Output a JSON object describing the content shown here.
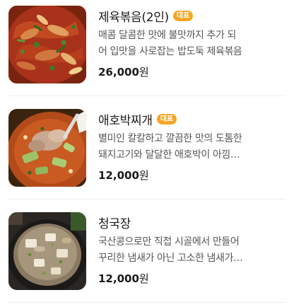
{
  "menu": {
    "items": [
      {
        "name": "제육볶음(2인)",
        "badge": "대표",
        "description_line1": "매콤 달콤한 맛에 불맛까지 추가 되",
        "description_line2": "어 입맛을 사로잡는 밥도둑 제육볶음",
        "price_amount": "26,000",
        "price_unit": "원",
        "photo_icon": "stir-fried-pork-photo"
      },
      {
        "name": "애호박찌개",
        "badge": "대표",
        "description_line1": "별미인 칼칼하고 깔끔한 맛의 도톰한",
        "description_line2": "돼지고기와 달달한 애호박이 아낌…",
        "price_amount": "12,000",
        "price_unit": "원",
        "photo_icon": "zucchini-stew-photo"
      },
      {
        "name": "청국장",
        "badge": "",
        "description_line1": "국산콩으로만 직접 시골에서 만들어",
        "description_line2": "꾸리한 냄새가 아닌 고소한 냄새가…",
        "price_amount": "12,000",
        "price_unit": "원",
        "photo_icon": "soybean-paste-stew-photo"
      }
    ]
  },
  "colors": {
    "badge_bg": "#f5a623",
    "name_text": "#1a1a1a",
    "description_text": "#555555",
    "divider": "#eeeeee"
  }
}
